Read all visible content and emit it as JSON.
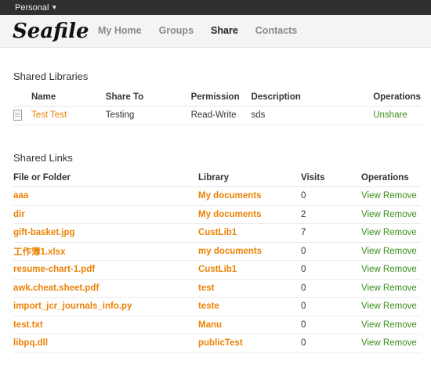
{
  "topbar": {
    "account_label": "Personal"
  },
  "header": {
    "logo_text": "Seafile",
    "nav": [
      "My Home",
      "Groups",
      "Share",
      "Contacts"
    ],
    "active_nav": "Share"
  },
  "shared_libraries": {
    "title": "Shared Libraries",
    "headers": [
      "Name",
      "Share To",
      "Permission",
      "Description",
      "Operations"
    ],
    "rows": [
      {
        "name": "Test Test",
        "share_to": "Testing",
        "permission": "Read-Write",
        "description": "sds",
        "operation": "Unshare"
      }
    ]
  },
  "shared_links": {
    "title": "Shared Links",
    "headers": [
      "File or Folder",
      "Library",
      "Visits",
      "Operations"
    ],
    "view_label": "View",
    "remove_label": "Remove",
    "rows": [
      {
        "file": "aaa",
        "library": "My documents",
        "visits": "0"
      },
      {
        "file": "dir",
        "library": "My documents",
        "visits": "2"
      },
      {
        "file": "gift-basket.jpg",
        "library": "CustLib1",
        "visits": "7"
      },
      {
        "file": "工作簿1.xlsx",
        "library": "my documents",
        "visits": "0"
      },
      {
        "file": "resume-chart-1.pdf",
        "library": "CustLib1",
        "visits": "0"
      },
      {
        "file": "awk.cheat.sheet.pdf",
        "library": "test",
        "visits": "0"
      },
      {
        "file": "import_jcr_journals_info.py",
        "library": "teste",
        "visits": "0"
      },
      {
        "file": "test.txt",
        "library": "Manu",
        "visits": "0"
      },
      {
        "file": "libpq.dll",
        "library": "publicTest",
        "visits": "0"
      }
    ]
  },
  "colors": {
    "link": "#eb8205",
    "operation": "#3a8e1c",
    "topbar": "#2f2f2f"
  }
}
